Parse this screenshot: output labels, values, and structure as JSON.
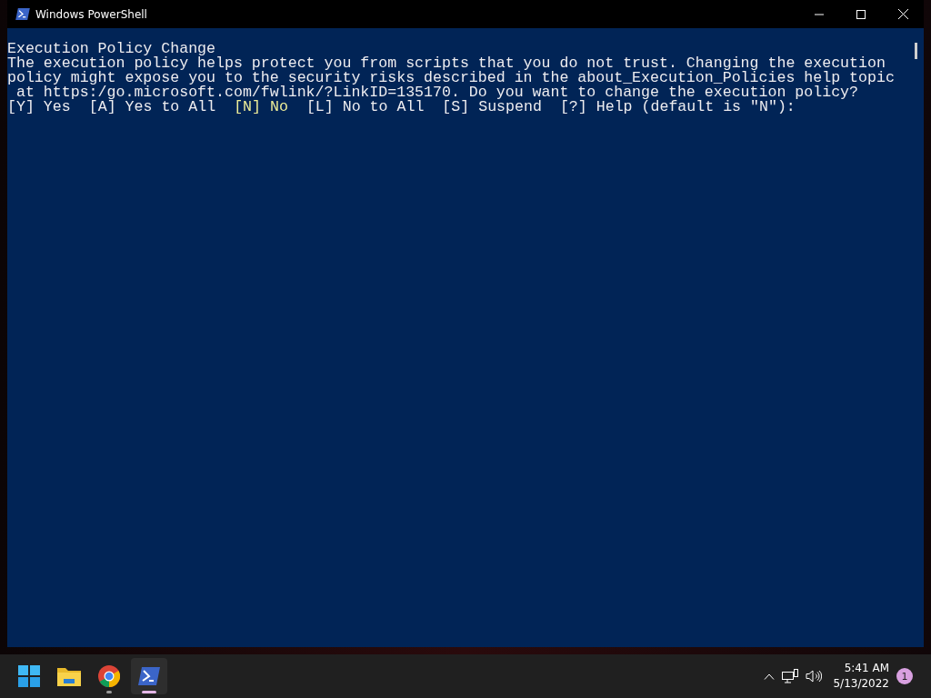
{
  "window": {
    "title": "Windows PowerShell"
  },
  "console": {
    "heading": "Execution Policy Change",
    "lines": [
      "The execution policy helps protect you from scripts that you do not trust. Changing the execution",
      "policy might expose you to the security risks described in the about_Execution_Policies help topic",
      " at https:/go.microsoft.com/fwlink/?LinkID=135170. Do you want to change the execution policy?"
    ],
    "options": [
      {
        "label": "[Y] Yes",
        "selected": false
      },
      {
        "label": "[A] Yes to All",
        "selected": false
      },
      {
        "label": "[N] No",
        "selected": true
      },
      {
        "label": "[L] No to All",
        "selected": false
      },
      {
        "label": "[S] Suspend",
        "selected": false
      },
      {
        "label": "[?] Help (default is \"N\"):",
        "selected": false
      }
    ]
  },
  "taskbar": {
    "apps": [
      {
        "kind": "start",
        "active": false
      },
      {
        "kind": "folder",
        "active": false
      },
      {
        "kind": "browser",
        "active": false
      },
      {
        "kind": "terminal",
        "active": true
      }
    ],
    "time": "5:41 AM",
    "date": "5/13/2022",
    "notifications": "1"
  }
}
